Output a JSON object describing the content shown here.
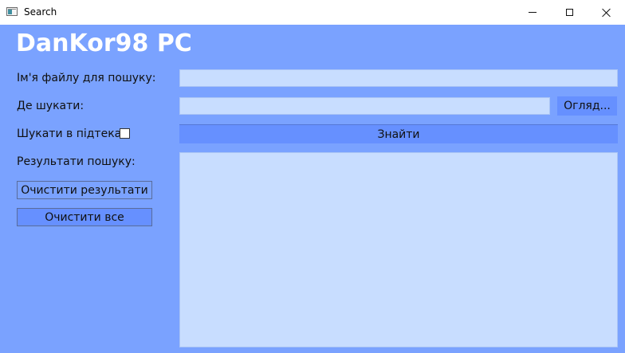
{
  "window": {
    "title": "Search",
    "controls": {
      "minimize_icon": "minimize-icon",
      "maximize_icon": "maximize-icon",
      "close_icon": "close-icon"
    }
  },
  "app": {
    "brand": "DanKor98 PC"
  },
  "form": {
    "filename_label": "Ім'я файлу для пошуку:",
    "filename_value": "",
    "where_label": "Де шукати:",
    "where_value": "",
    "browse_button": "Огляд...",
    "subdirs_label": "Шукати в підтеках",
    "subdirs_checked": false,
    "search_button": "Знайти",
    "results_label": "Результати пошуку:",
    "results_value": "",
    "clear_results_button": "Очистити результати",
    "clear_all_button": "Очистити все"
  },
  "colors": {
    "background": "#7aa2ff",
    "input_background": "#c8ddff",
    "button_accent": "#6690ff",
    "brand_text": "#ffffff"
  }
}
